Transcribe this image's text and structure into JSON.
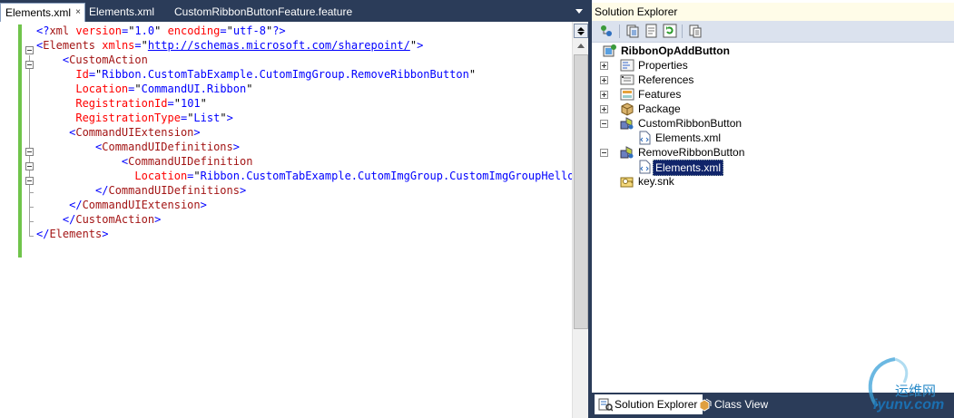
{
  "editor": {
    "tabs": [
      {
        "label": "Elements.xml",
        "active": true
      },
      {
        "label": "Elements.xml",
        "active": false
      },
      {
        "label": "CustomRibbonButtonFeature.feature",
        "active": false
      }
    ],
    "tab_close_glyph": "×",
    "code_lines": [
      [
        {
          "t": "<?",
          "c": "b"
        },
        {
          "t": "xml",
          "c": "m"
        },
        {
          "t": " ",
          "c": "k"
        },
        {
          "t": "version",
          "c": "r"
        },
        {
          "t": "=",
          "c": "b"
        },
        {
          "t": "\"",
          "c": "k"
        },
        {
          "t": "1.0",
          "c": "b"
        },
        {
          "t": "\"",
          "c": "k"
        },
        {
          "t": " ",
          "c": "k"
        },
        {
          "t": "encoding",
          "c": "r"
        },
        {
          "t": "=",
          "c": "b"
        },
        {
          "t": "\"",
          "c": "k"
        },
        {
          "t": "utf-8",
          "c": "b"
        },
        {
          "t": "\"",
          "c": "k"
        },
        {
          "t": "?>",
          "c": "b"
        }
      ],
      [
        {
          "t": "<",
          "c": "b"
        },
        {
          "t": "Elements",
          "c": "m"
        },
        {
          "t": " ",
          "c": "k"
        },
        {
          "t": "xmlns",
          "c": "r"
        },
        {
          "t": "=",
          "c": "b"
        },
        {
          "t": "\"",
          "c": "k"
        },
        {
          "t": "http://schemas.microsoft.com/sharepoint/",
          "c": "u"
        },
        {
          "t": "\"",
          "c": "k"
        },
        {
          "t": ">",
          "c": "b"
        }
      ],
      [
        {
          "t": "    <",
          "c": "b"
        },
        {
          "t": "CustomAction",
          "c": "m"
        }
      ],
      [
        {
          "t": "      ",
          "c": "k"
        },
        {
          "t": "Id",
          "c": "r"
        },
        {
          "t": "=",
          "c": "b"
        },
        {
          "t": "\"",
          "c": "k"
        },
        {
          "t": "Ribbon.CustomTabExample.CutomImgGroup.RemoveRibbonButton",
          "c": "b"
        },
        {
          "t": "\"",
          "c": "k"
        }
      ],
      [
        {
          "t": "      ",
          "c": "k"
        },
        {
          "t": "Location",
          "c": "r"
        },
        {
          "t": "=",
          "c": "b"
        },
        {
          "t": "\"",
          "c": "k"
        },
        {
          "t": "CommandUI.Ribbon",
          "c": "b"
        },
        {
          "t": "\"",
          "c": "k"
        }
      ],
      [
        {
          "t": "      ",
          "c": "k"
        },
        {
          "t": "RegistrationId",
          "c": "r"
        },
        {
          "t": "=",
          "c": "b"
        },
        {
          "t": "\"",
          "c": "k"
        },
        {
          "t": "101",
          "c": "b"
        },
        {
          "t": "\"",
          "c": "k"
        }
      ],
      [
        {
          "t": "      ",
          "c": "k"
        },
        {
          "t": "RegistrationType",
          "c": "r"
        },
        {
          "t": "=",
          "c": "b"
        },
        {
          "t": "\"",
          "c": "k"
        },
        {
          "t": "List",
          "c": "b"
        },
        {
          "t": "\"",
          "c": "k"
        },
        {
          "t": ">",
          "c": "b"
        }
      ],
      [
        {
          "t": "     <",
          "c": "b"
        },
        {
          "t": "CommandUIExtension",
          "c": "m"
        },
        {
          "t": ">",
          "c": "b"
        }
      ],
      [
        {
          "t": "         <",
          "c": "b"
        },
        {
          "t": "CommandUIDefinitions",
          "c": "m"
        },
        {
          "t": ">",
          "c": "b"
        }
      ],
      [
        {
          "t": "             <",
          "c": "b"
        },
        {
          "t": "CommandUIDefinition",
          "c": "m"
        }
      ],
      [
        {
          "t": "               ",
          "c": "k"
        },
        {
          "t": "Location",
          "c": "r"
        },
        {
          "t": "=",
          "c": "b"
        },
        {
          "t": "\"",
          "c": "k"
        },
        {
          "t": "Ribbon.CustomTabExample.CutomImgGroup.CustomImgGroupHello",
          "c": "b"
        }
      ],
      [
        {
          "t": "         </",
          "c": "b"
        },
        {
          "t": "CommandUIDefinitions",
          "c": "m"
        },
        {
          "t": ">",
          "c": "b"
        }
      ],
      [
        {
          "t": "     </",
          "c": "b"
        },
        {
          "t": "CommandUIExtension",
          "c": "m"
        },
        {
          "t": ">",
          "c": "b"
        }
      ],
      [
        {
          "t": "    </",
          "c": "b"
        },
        {
          "t": "CustomAction",
          "c": "m"
        },
        {
          "t": ">",
          "c": "b"
        }
      ],
      [
        {
          "t": "</",
          "c": "b"
        },
        {
          "t": "Elements",
          "c": "m"
        },
        {
          "t": ">",
          "c": "b"
        }
      ]
    ]
  },
  "colors": {
    "b": "#0000ff",
    "m": "#a31515",
    "r": "#ff0000",
    "k": "#000000",
    "u": "#0000ff"
  },
  "solution_explorer": {
    "title": "Solution Explorer",
    "tree": [
      {
        "label": "RibbonOpAddButton",
        "indent": 0,
        "expander": "none",
        "icon": "project-icon",
        "bold": true,
        "selected": false
      },
      {
        "label": "Properties",
        "indent": 1,
        "expander": "plus",
        "icon": "properties-icon",
        "bold": false,
        "selected": false
      },
      {
        "label": "References",
        "indent": 1,
        "expander": "plus",
        "icon": "references-icon",
        "bold": false,
        "selected": false
      },
      {
        "label": "Features",
        "indent": 1,
        "expander": "plus",
        "icon": "folder-icon",
        "bold": false,
        "selected": false
      },
      {
        "label": "Package",
        "indent": 1,
        "expander": "plus",
        "icon": "folder-icon",
        "bold": false,
        "selected": false
      },
      {
        "label": "CustomRibbonButton",
        "indent": 1,
        "expander": "minus",
        "icon": "module-icon",
        "bold": false,
        "selected": false
      },
      {
        "label": "Elements.xml",
        "indent": 2,
        "expander": "none",
        "icon": "xml-file-icon",
        "bold": false,
        "selected": false
      },
      {
        "label": "RemoveRibbonButton",
        "indent": 1,
        "expander": "minus",
        "icon": "module-icon",
        "bold": false,
        "selected": false
      },
      {
        "label": "Elements.xml",
        "indent": 2,
        "expander": "none",
        "icon": "xml-file-icon",
        "bold": false,
        "selected": true
      },
      {
        "label": "key.snk",
        "indent": 1,
        "expander": "none",
        "icon": "key-icon",
        "bold": false,
        "selected": false
      }
    ],
    "bottom_tabs": [
      {
        "label": "Solution Explorer",
        "active": true,
        "icon": "solution-explorer-icon"
      },
      {
        "label": "Class View",
        "active": false,
        "icon": "class-view-icon"
      }
    ]
  },
  "watermark": {
    "line1": "运维网",
    "line2": "iyunv.com"
  }
}
